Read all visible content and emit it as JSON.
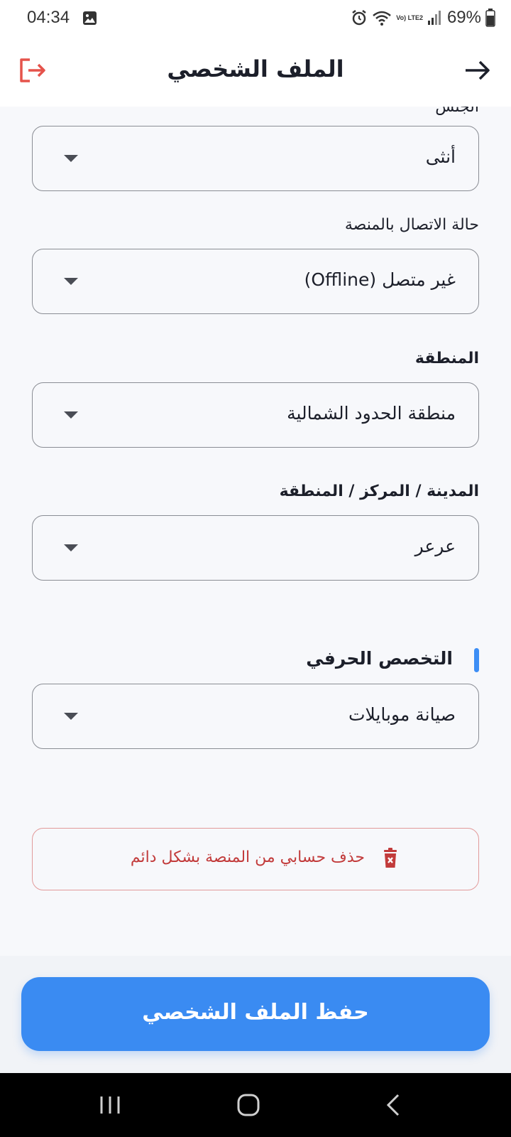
{
  "status_bar": {
    "time": "04:34",
    "battery": "69%",
    "network": "Vo) LTE2"
  },
  "header": {
    "title": "الملف الشخصي"
  },
  "fields": {
    "gender": {
      "label": "الجنس",
      "value": "أنثى"
    },
    "connection": {
      "label": "حالة الاتصال بالمنصة",
      "value": "غير متصل (Offline)"
    },
    "region": {
      "label": "المنطقة",
      "value": "منطقة الحدود الشمالية"
    },
    "city": {
      "label": "المدينة / المركز / المنطقة",
      "value": "عرعر"
    }
  },
  "specialty": {
    "section_title": "التخصص الحرفي",
    "value": "صيانة موبايلات"
  },
  "delete_account": {
    "label": "حذف حسابي من المنصة بشكل دائم"
  },
  "save": {
    "label": "حفظ الملف الشخصي"
  },
  "colors": {
    "primary": "#3a8bf2",
    "danger": "#c23b3b",
    "logout": "#e5534b",
    "annotation_arrow": "#e8211d"
  },
  "icons": [
    "gallery-icon",
    "alarm-icon",
    "wifi-icon",
    "signal-icon",
    "battery-icon",
    "logout-icon",
    "back-arrow-icon",
    "trash-icon",
    "recents-icon",
    "home-icon",
    "back-nav-icon"
  ]
}
